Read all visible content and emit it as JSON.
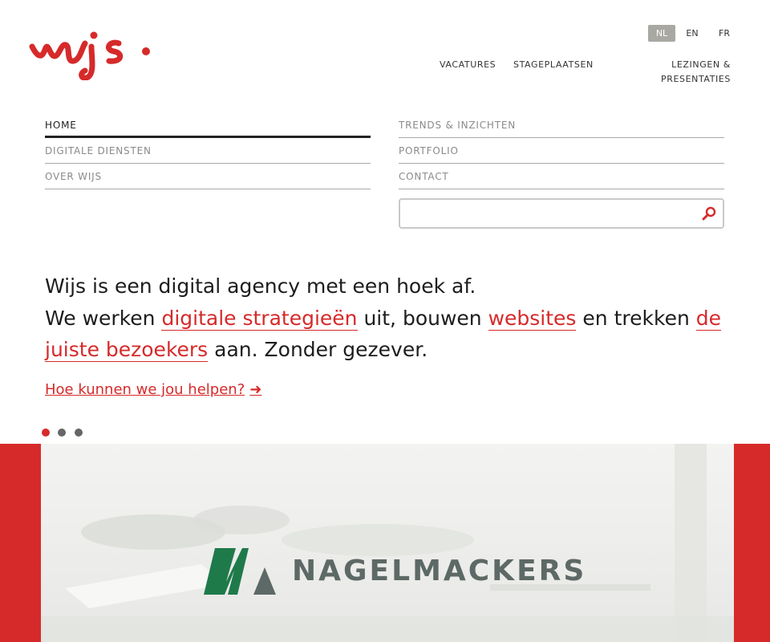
{
  "brand": {
    "logo_text": "wijs",
    "accent_color": "#d62a2a"
  },
  "languages": [
    {
      "code": "NL",
      "active": true
    },
    {
      "code": "EN",
      "active": false
    },
    {
      "code": "FR",
      "active": false
    }
  ],
  "top_nav": {
    "vacatures": "VACATURES",
    "stageplaatsen": "STAGEPLAATSEN",
    "lezingen_line1": "LEZINGEN &",
    "lezingen_line2": "PRESENTATIES"
  },
  "main_nav": {
    "home": "HOME",
    "digitale_diensten": "DIGITALE DIENSTEN",
    "over_wijs": "OVER WIJS",
    "trends": "TRENDS & INZICHTEN",
    "portfolio": "PORTFOLIO",
    "contact": "CONTACT"
  },
  "search": {
    "placeholder": "",
    "value": "",
    "icon": "search-icon"
  },
  "hero": {
    "line1": "Wijs is een digital agency met een hoek af.",
    "part_we_werken": "We werken ",
    "link_strategieen": "digitale strategieën",
    "part_uit_bouwen": " uit, bouwen ",
    "link_websites": "websites",
    "part_en_trekken": " en trekken ",
    "link_bezoekers": "de juiste bezoekers",
    "part_aan": " aan. Zonder gezever."
  },
  "cta": {
    "label": "Hoe kunnen we jou helpen?",
    "arrow": "➜"
  },
  "carousel": {
    "slides": 3,
    "active_index": 0
  },
  "banner": {
    "client_name": "NAGELMACKERS",
    "logo_colors": [
      "#1f7a4a",
      "#5d6966"
    ]
  }
}
